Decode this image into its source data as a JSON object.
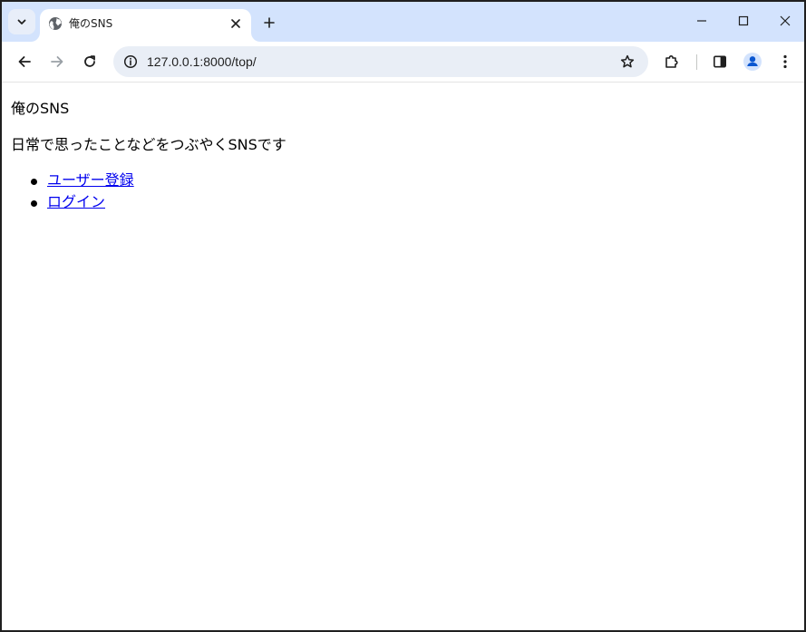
{
  "browser": {
    "tab": {
      "title": "俺のSNS",
      "favicon": "globe-icon"
    },
    "url": "127.0.0.1:8000/top/",
    "icons": {
      "tab_search": "chevron-down-icon",
      "close_tab": "close-icon",
      "new_tab": "plus-icon",
      "minimize": "minimize-icon",
      "maximize": "maximize-icon",
      "close_window": "close-icon",
      "back": "back-arrow-icon",
      "forward": "forward-arrow-icon",
      "reload": "reload-icon",
      "site_info": "info-icon",
      "bookmark": "star-icon",
      "extensions": "puzzle-icon",
      "side_panel": "side-panel-icon",
      "profile": "profile-icon",
      "menu": "kebab-menu-icon"
    },
    "colors": {
      "tabstrip_bg": "#d3e3fd",
      "omnibox_bg": "#e9eef6",
      "profile_bg": "#d3e3fd",
      "profile_fg": "#0b57d0"
    }
  },
  "page": {
    "site_title": "俺のSNS",
    "description": "日常で思ったことなどをつぶやくSNSです",
    "links": [
      {
        "label": "ユーザー登録"
      },
      {
        "label": "ログイン"
      }
    ],
    "link_color": "#0000ee"
  }
}
